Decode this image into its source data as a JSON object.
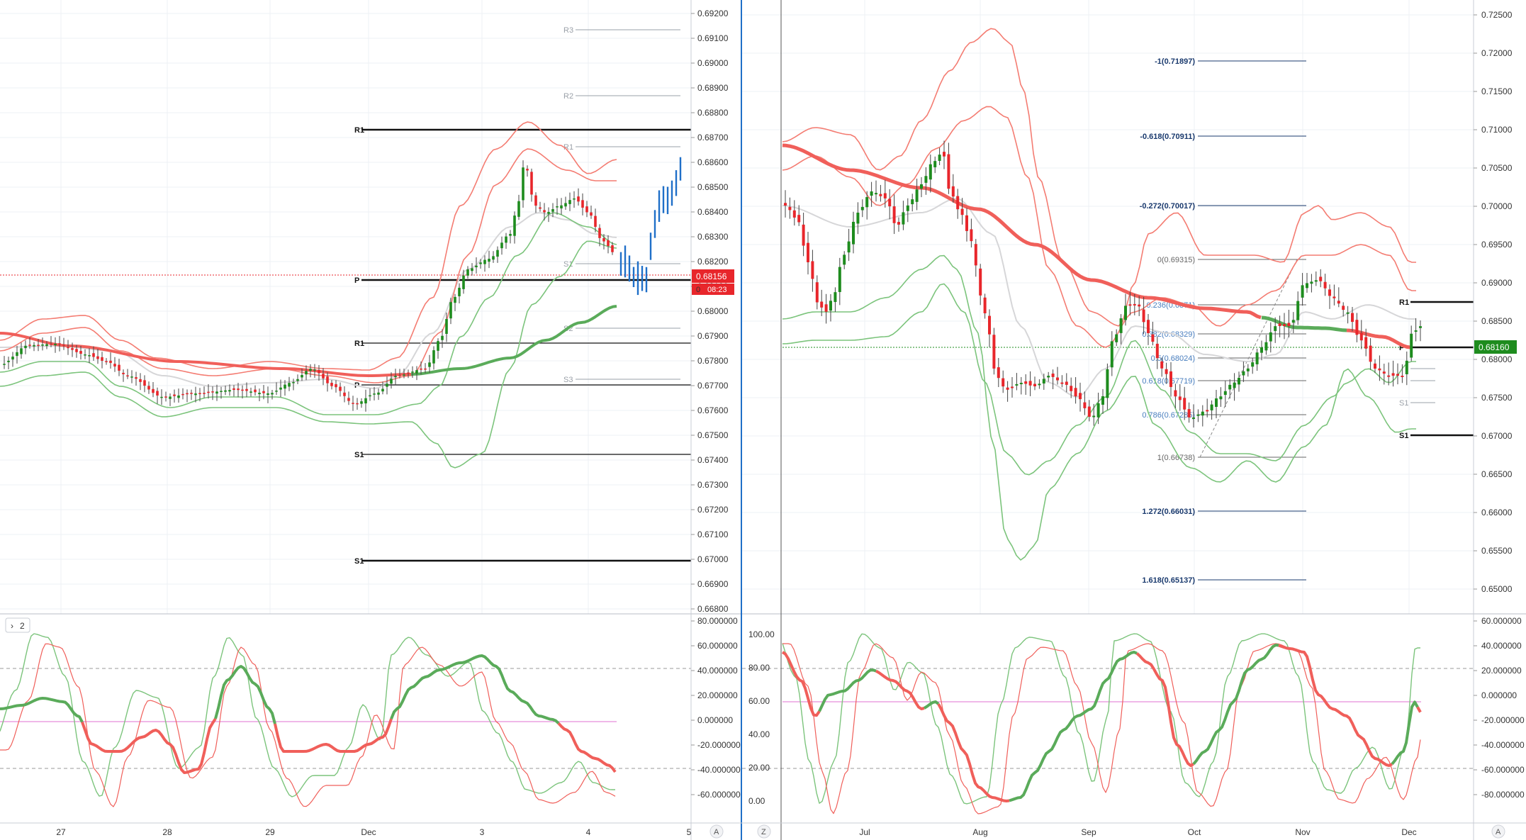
{
  "left_chart": {
    "price_axis": [
      "0.69200",
      "0.69100",
      "0.69000",
      "0.68900",
      "0.68800",
      "0.68700",
      "0.68600",
      "0.68500",
      "0.68400",
      "0.68300",
      "0.68200",
      "0.68100",
      "0.68000",
      "0.67900",
      "0.67800",
      "0.67700",
      "0.67600",
      "0.67500",
      "0.67400",
      "0.67300",
      "0.67200",
      "0.67100",
      "0.67000",
      "0.66900",
      "0.66800"
    ],
    "time_axis": [
      "27",
      "28",
      "29",
      "Dec",
      "3",
      "4",
      "5"
    ],
    "current_price": "0.68156",
    "countdown": "08:23",
    "pivot_labels": {
      "r3": "R3",
      "r2": "R2",
      "r1_small": "R1",
      "s1_small": "S1",
      "s2": "S2",
      "s3": "S3",
      "r1_week": "R1",
      "p_week": "P",
      "r1_day": "R1",
      "p_day": "P",
      "s1_day": "S1",
      "s1_week": "S1"
    },
    "auto_scale": "A"
  },
  "left_osc": {
    "pane_badge": "2",
    "axis": [
      "80.000000",
      "60.000000",
      "40.000000",
      "20.000000",
      "0.000000",
      "-20.000000",
      "-40.000000",
      "-60.000000"
    ]
  },
  "right_chart": {
    "price_axis": [
      "0.72500",
      "0.72000",
      "0.71500",
      "0.71000",
      "0.70500",
      "0.70000",
      "0.69500",
      "0.69000",
      "0.68500",
      "0.68000",
      "0.67500",
      "0.67000",
      "0.66500",
      "0.66000",
      "0.65500",
      "0.65000"
    ],
    "time_axis": [
      "Jul",
      "Aug",
      "Sep",
      "Oct",
      "Nov",
      "Dec"
    ],
    "current_price": "0.68160",
    "fib_labels": [
      "-1(0.71897)",
      "-0.618(0.70911)",
      "-0.272(0.70017)",
      "0(0.69315)",
      "0.236(0.6871)",
      "0.382(0.68329)",
      "0.5(0.68024)",
      "0.618(0.67719)",
      "0.786(0.67285)",
      "1(0.66738)",
      "1.272(0.66031)",
      "1.618(0.65137)"
    ],
    "pivot_labels": {
      "r1": "R1",
      "p": "P",
      "s1_small": "S1",
      "s1": "S1"
    },
    "zoom_btn": "Z",
    "auto_scale": "A"
  },
  "right_osc": {
    "left_axis": [
      "100.00",
      "80.00",
      "60.00",
      "40.00",
      "20.00",
      "0.00"
    ],
    "right_axis": [
      "60.000000",
      "40.000000",
      "20.000000",
      "0.000000",
      "-20.000000",
      "-40.000000",
      "-60.000000",
      "-80.000000"
    ]
  },
  "colors": {
    "bull": "#1e8c1e",
    "bear": "#e8262b",
    "ma_red": "#f05f5a",
    "ma_green": "#5aab5a",
    "band_red": "#f47c72",
    "band_green": "#7cc47c",
    "blue": "#1f6fc8",
    "divider": "#1f6fc8",
    "grid": "#eef0f4"
  },
  "chart_data": [
    {
      "type": "candlestick",
      "title": "",
      "x_ticks": [
        "27",
        "28",
        "29",
        "Dec",
        "3",
        "4",
        "5"
      ],
      "ylim": [
        0.668,
        0.6925
      ],
      "last_price": 0.68156,
      "pivots": {
        "R3": 0.691,
        "R2": 0.6885,
        "R1": 0.6867,
        "S1": 0.6819,
        "S2": 0.6794,
        "S3": 0.6773,
        "P": 0.6812
      },
      "series": [
        {
          "name": "",
          "values": [
            0.6788,
            0.679,
            0.6786,
            0.6782,
            0.6776,
            0.6768,
            0.6763,
            0.6766,
            0.677,
            0.6768,
            0.6765,
            0.677,
            0.6774,
            0.6778,
            0.677,
            0.6762,
            0.6768,
            0.6776,
            0.6778,
            0.679,
            0.6802,
            0.6815,
            0.6822,
            0.6818,
            0.684,
            0.6855,
            0.6845,
            0.6842,
            0.6845,
            0.6848,
            0.6838,
            0.6826,
            0.6822,
            0.6812,
            0.6809,
            0.6812,
            0.6835,
            0.685,
            0.6858
          ]
        }
      ]
    },
    {
      "type": "candlestick",
      "title": "",
      "x_ticks": [
        "Jul",
        "Aug",
        "Sep",
        "Oct",
        "Nov",
        "Dec"
      ],
      "ylim": [
        0.6455,
        0.7255
      ],
      "last_price": 0.6816,
      "fibonacci": [
        {
          "level": "-1",
          "price": 0.71897
        },
        {
          "level": "-0.618",
          "price": 0.70911
        },
        {
          "level": "-0.272",
          "price": 0.70017
        },
        {
          "level": "0",
          "price": 0.69315
        },
        {
          "level": "0.236",
          "price": 0.6871
        },
        {
          "level": "0.382",
          "price": 0.68329
        },
        {
          "level": "0.5",
          "price": 0.68024
        },
        {
          "level": "0.618",
          "price": 0.67719
        },
        {
          "level": "0.786",
          "price": 0.67285
        },
        {
          "level": "1",
          "price": 0.66738
        },
        {
          "level": "1.272",
          "price": 0.66031
        },
        {
          "level": "1.618",
          "price": 0.65137
        }
      ],
      "series": [
        {
          "name": "",
          "values": [
            0.697,
            0.6935,
            0.6895,
            0.686,
            0.69,
            0.6955,
            0.699,
            0.696,
            0.6935,
            0.6965,
            0.7025,
            0.699,
            0.694,
            0.69,
            0.679,
            0.6755,
            0.677,
            0.678,
            0.676,
            0.6775,
            0.678,
            0.674,
            0.672,
            0.676,
            0.683,
            0.686,
            0.6855,
            0.68,
            0.677,
            0.674,
            0.673,
            0.674,
            0.677,
            0.6745,
            0.679,
            0.685,
            0.686,
            0.69,
            0.6885,
            0.683,
            0.681,
            0.68,
            0.679,
            0.676,
            0.6775,
            0.6816
          ]
        }
      ]
    }
  ]
}
